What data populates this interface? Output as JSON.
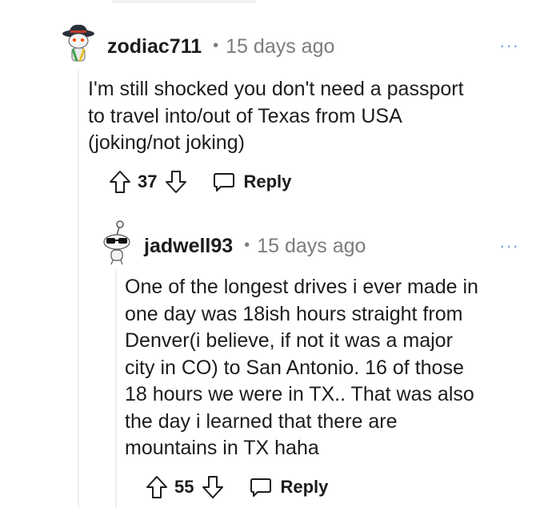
{
  "comments": [
    {
      "username": "zodiac711",
      "separator": "•",
      "time": "15 days ago",
      "body_lines": [
        "I'm still shocked you don't need a passport",
        "to travel into/out of Texas from USA",
        "(joking/not joking)"
      ],
      "score": "37",
      "reply_label": "Reply",
      "more_label": "···",
      "avatar_icon": "snoo-avatar-hat-icon"
    },
    {
      "username": "jadwell93",
      "separator": "•",
      "time": "15 days ago",
      "body_lines": [
        "One of the longest drives i ever made in",
        "one day was 18ish hours straight from",
        "Denver(i believe, if not it was a major",
        "city in CO) to San Antonio. 16 of those",
        "18 hours we were in TX.. That was also",
        "the day i learned that there are",
        "mountains in TX haha"
      ],
      "score": "55",
      "reply_label": "Reply",
      "more_label": "···",
      "avatar_icon": "snoo-avatar-sunglasses-icon"
    }
  ],
  "icons": {
    "upvote": "upvote-arrow-icon",
    "downvote": "downvote-arrow-icon",
    "reply": "reply-bubble-icon"
  },
  "colors": {
    "text": "#1c1c1c",
    "meta": "#7c7c7c",
    "more": "#7c9cd0",
    "thread_line": "#edeff1"
  }
}
